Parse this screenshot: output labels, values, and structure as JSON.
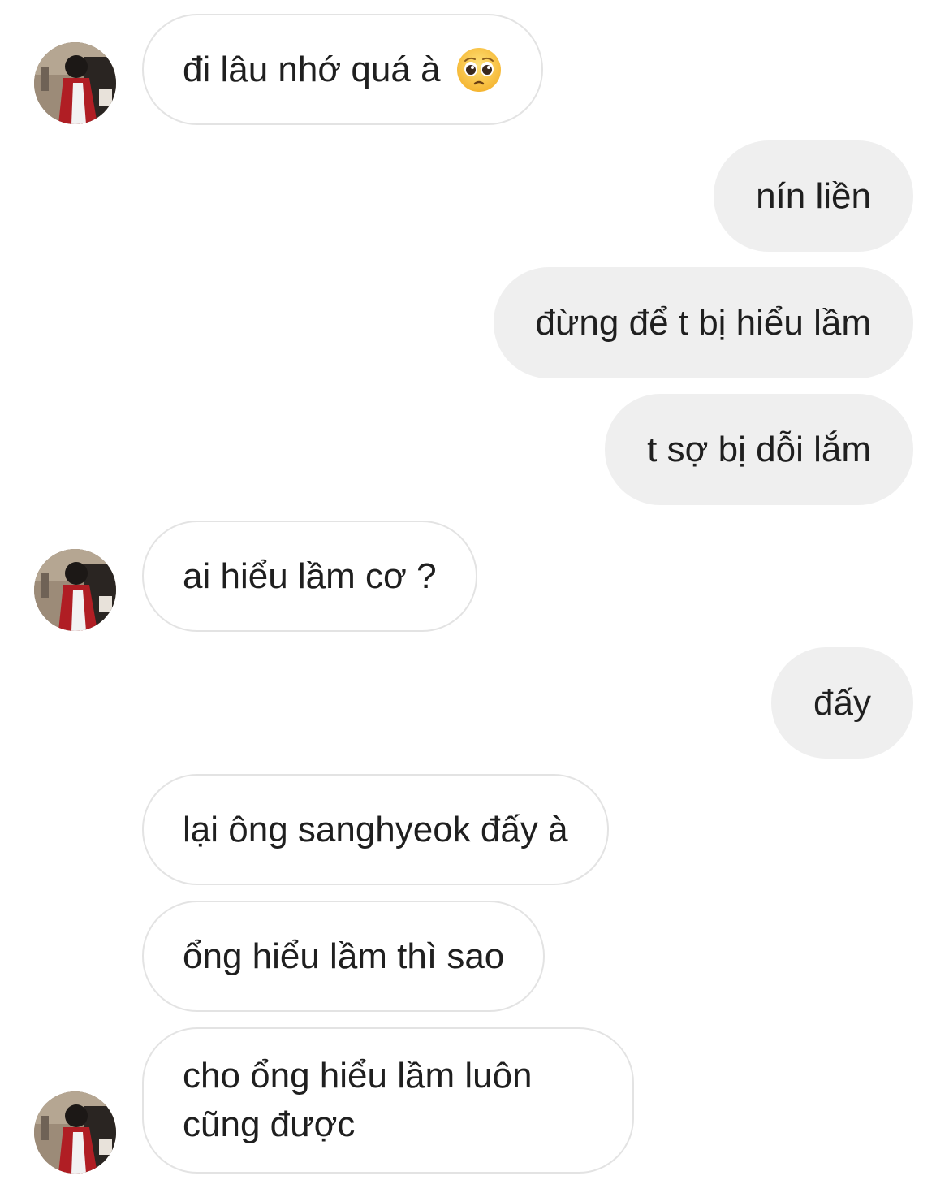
{
  "messages": [
    {
      "sender": "them",
      "text": "đi lâu nhớ quá à",
      "emoji": "pleading-face-icon"
    },
    {
      "sender": "me",
      "text": "nín liền"
    },
    {
      "sender": "me",
      "text": "đừng để t bị hiểu lầm"
    },
    {
      "sender": "me",
      "text": "t sợ bị dỗi lắm"
    },
    {
      "sender": "them",
      "text": "ai hiểu lầm cơ ?"
    },
    {
      "sender": "me",
      "text": "đấy"
    },
    {
      "sender": "them",
      "text": "lại ông sanghyeok đấy à"
    },
    {
      "sender": "them",
      "text": "ổng hiểu lầm thì sao"
    },
    {
      "sender": "them",
      "text": "cho ổng hiểu lầm luôn cũng được"
    }
  ],
  "colors": {
    "incoming_bg": "#ffffff",
    "incoming_border": "#e3e3e3",
    "outgoing_bg": "#efefef",
    "text": "#1f1f1f"
  }
}
